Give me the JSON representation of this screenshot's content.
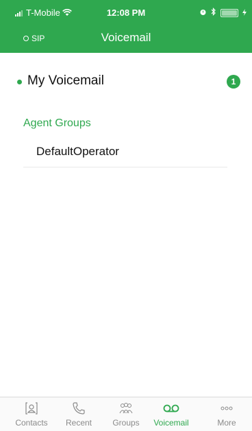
{
  "status_bar": {
    "carrier": "T-Mobile",
    "time": "12:08 PM"
  },
  "nav": {
    "sip_label": "SIP",
    "title": "Voicemail"
  },
  "voicemail": {
    "my_voicemail_label": "My Voicemail",
    "unread_count": "1"
  },
  "agent_groups": {
    "header": "Agent Groups",
    "items": [
      {
        "label": "DefaultOperator"
      }
    ]
  },
  "tab_bar": {
    "active": "Voicemail",
    "tabs": [
      {
        "label": "Contacts",
        "icon": "contacts-icon"
      },
      {
        "label": "Recent",
        "icon": "phone-icon"
      },
      {
        "label": "Groups",
        "icon": "groups-icon"
      },
      {
        "label": "Voicemail",
        "icon": "voicemail-icon"
      },
      {
        "label": "More",
        "icon": "more-icon"
      }
    ]
  },
  "colors": {
    "brand_green": "#2fa84f",
    "tab_inactive": "#8a8a8a"
  }
}
